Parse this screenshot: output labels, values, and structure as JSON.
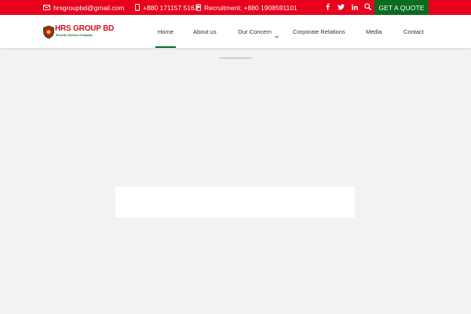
{
  "topbar": {
    "email": "hrsgroupbd@gmail.com",
    "phone": "+880 171157 5163",
    "recruitment": "Recruitment: +880 1908591101",
    "social_icons": [
      "facebook-icon",
      "twitter-icon",
      "linkedin-icon",
      "search-icon"
    ],
    "quote_label": "GET A QUOTE"
  },
  "brand": {
    "name": "HRS GROUP BD",
    "tagline": "Security Services Company"
  },
  "nav": {
    "items": [
      {
        "label": "Home",
        "active": true
      },
      {
        "label": "About us"
      },
      {
        "label": "Our Concern",
        "has_dropdown": true
      },
      {
        "label": "Corporate Relations"
      },
      {
        "label": "Media"
      },
      {
        "label": "Contact"
      }
    ]
  },
  "colors": {
    "topbar_red": "#e8001c",
    "accent_green": "#0b6b1f",
    "page_bg": "#f2f2f2"
  }
}
